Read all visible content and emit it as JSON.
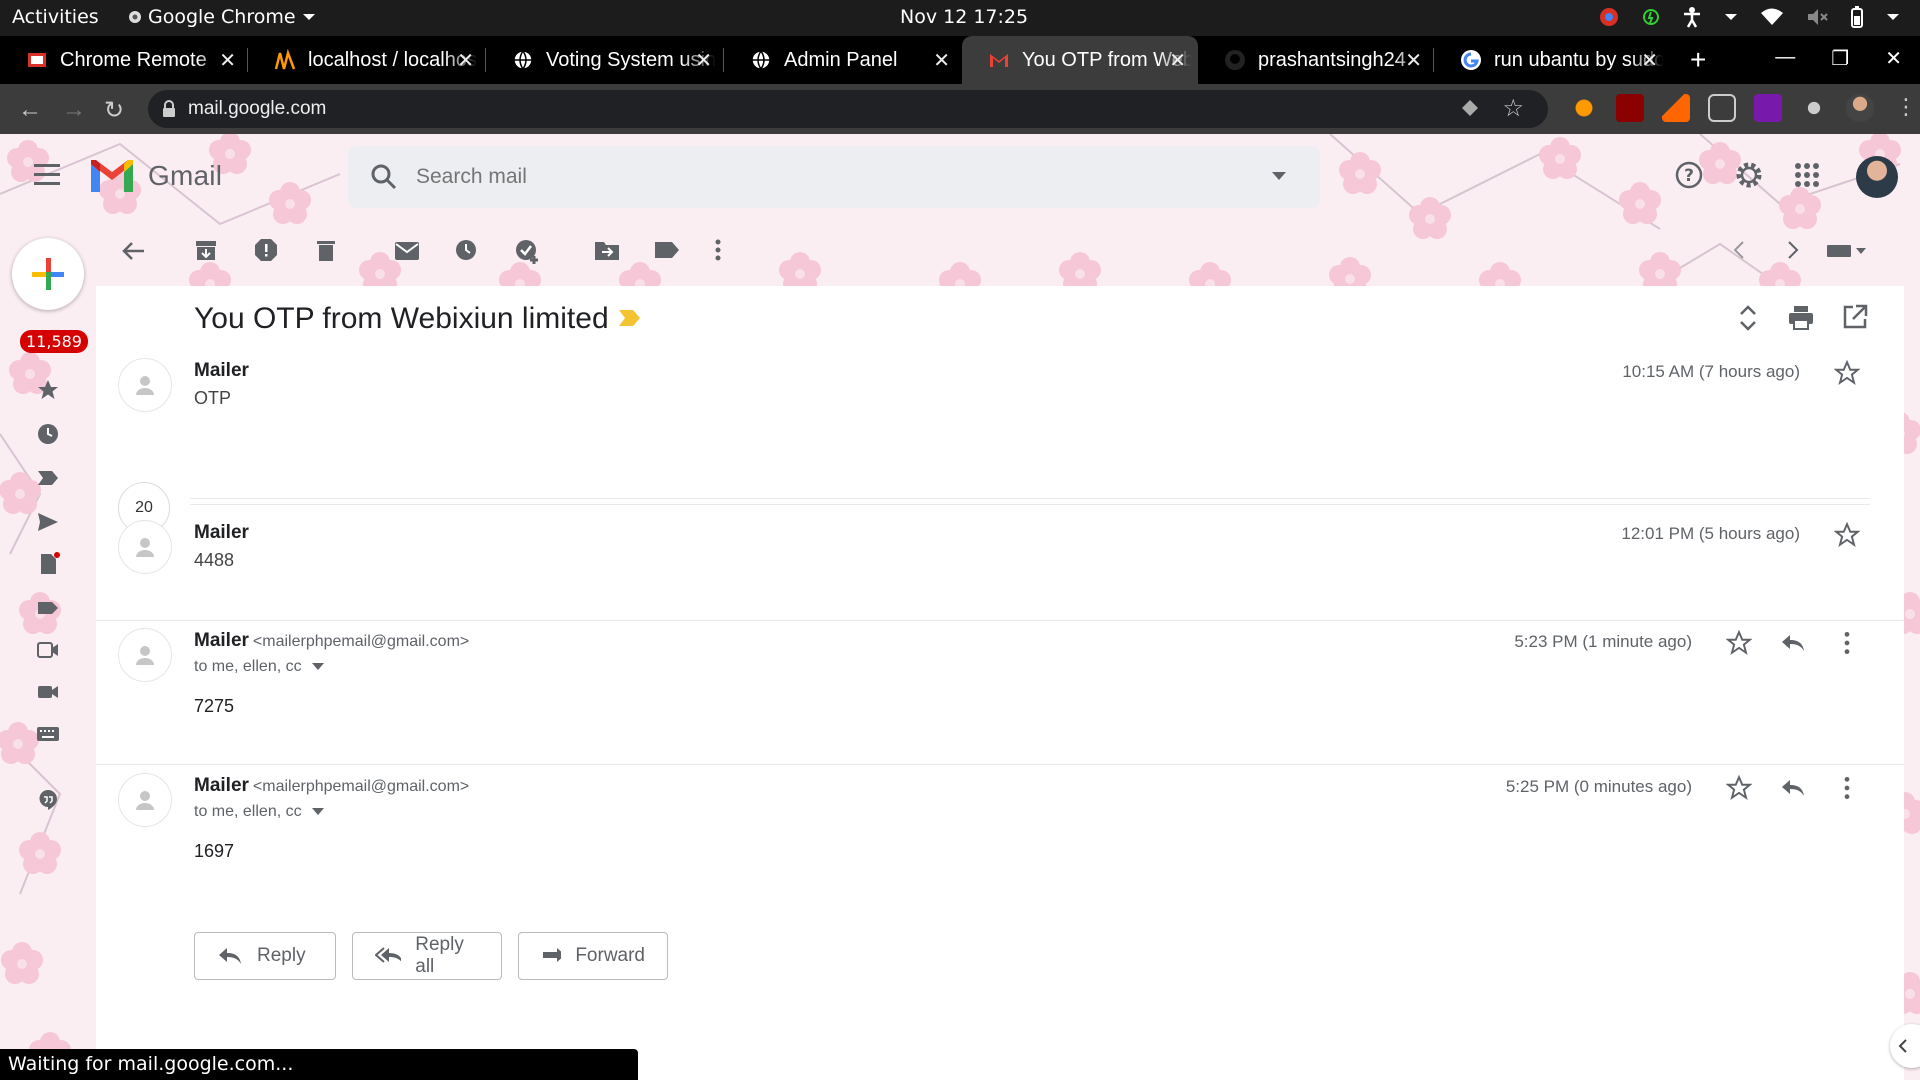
{
  "os": {
    "activities": "Activities",
    "app_name": "Google Chrome",
    "clock": "Nov 12  17:25"
  },
  "tabs": [
    {
      "title": "Chrome Remote",
      "favicon": "chrome-remote-icon"
    },
    {
      "title": "localhost / localhost",
      "favicon": "phpmyadmin-icon"
    },
    {
      "title": "Voting System using",
      "favicon": "globe-icon"
    },
    {
      "title": "Admin Panel",
      "favicon": "globe-icon"
    },
    {
      "title": "You OTP from Webixiun",
      "favicon": "gmail-icon",
      "active": true
    },
    {
      "title": "prashantsingh24",
      "favicon": "github-icon"
    },
    {
      "title": "run ubantu by sudo",
      "favicon": "google-icon"
    }
  ],
  "browser": {
    "url": "mail.google.com"
  },
  "gmail": {
    "wordmark": "Gmail",
    "search_placeholder": "Search mail",
    "unread_count": "11,589",
    "subject": "You OTP from Webixiun limited",
    "collapsed_count": "20",
    "messages": [
      {
        "sender": "Mailer",
        "email": "",
        "snippet": "OTP",
        "time": "10:15 AM (7 hours ago)",
        "to": "",
        "body": ""
      },
      {
        "sender": "Mailer",
        "email": "",
        "snippet": "4488",
        "time": "12:01 PM (5 hours ago)",
        "to": "",
        "body": ""
      },
      {
        "sender": "Mailer",
        "email": "<mailerphpemail@gmail.com>",
        "snippet": "",
        "time": "5:23 PM (1 minute ago)",
        "to": "to me, ellen, cc",
        "body": "7275"
      },
      {
        "sender": "Mailer",
        "email": "<mailerphpemail@gmail.com>",
        "snippet": "",
        "time": "5:25 PM (0 minutes ago)",
        "to": "to me, ellen, cc",
        "body": "1697"
      }
    ],
    "actions": {
      "reply": "Reply",
      "reply_all": "Reply all",
      "forward": "Forward"
    }
  },
  "status": "Waiting for mail.google.com...",
  "colors": {
    "accent_red": "#d50000",
    "theme_bg": "#fbeef3",
    "label_yellow": "#f4c430"
  }
}
